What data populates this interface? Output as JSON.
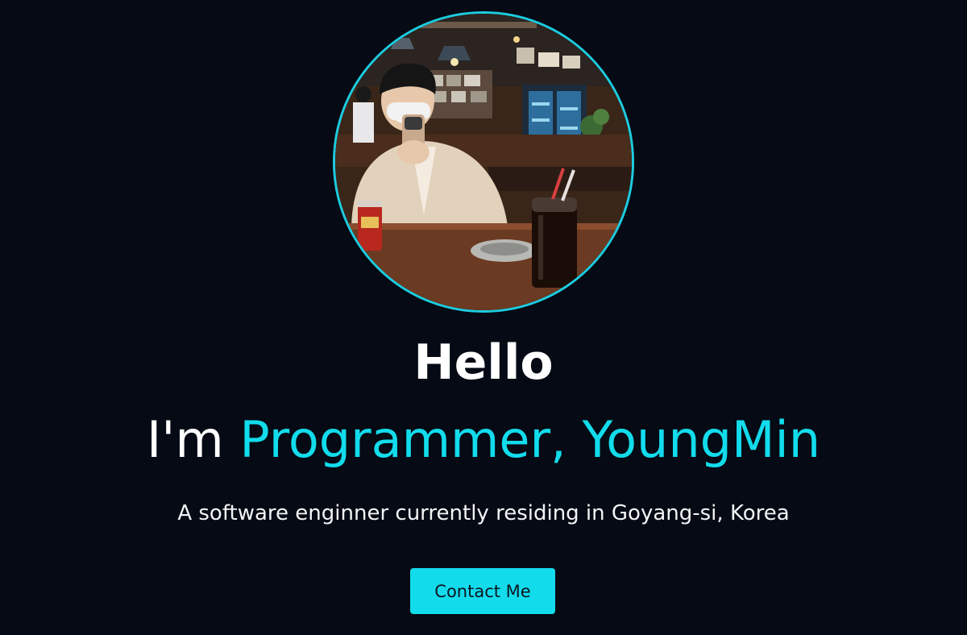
{
  "hero": {
    "greeting": "Hello",
    "intro_prefix": "I'm ",
    "intro_highlight": "Programmer, YoungMin",
    "subtitle": "A software enginner currently residing in Goyang-si, Korea",
    "contact_label": "Contact Me"
  },
  "colors": {
    "background": "#050a14",
    "accent": "#12dcec",
    "text": "#ffffff"
  }
}
